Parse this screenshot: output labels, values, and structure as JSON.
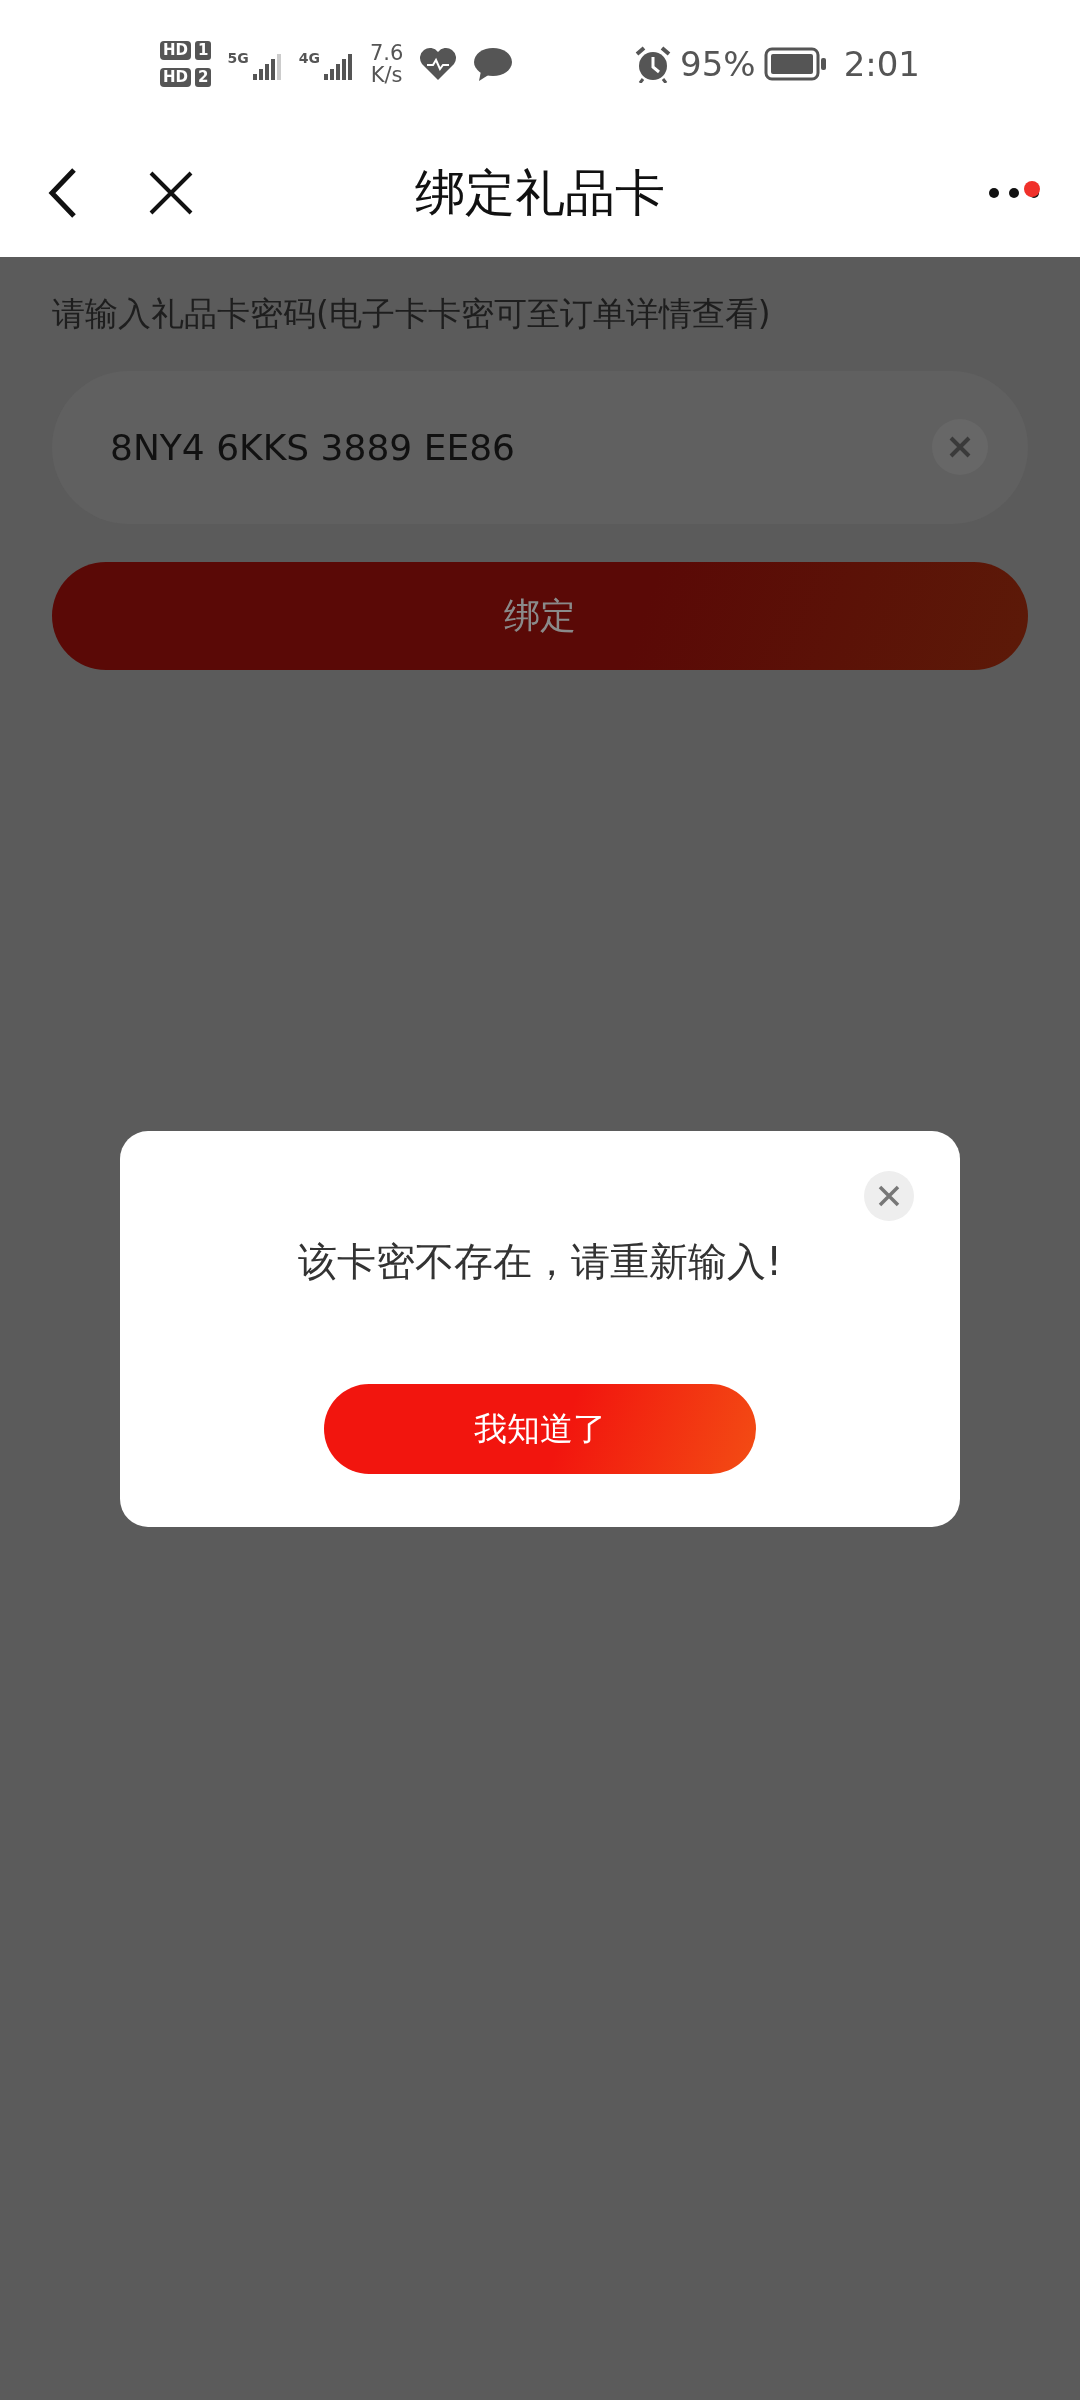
{
  "status_bar": {
    "sims": [
      {
        "badge": "HD",
        "slot": "1"
      },
      {
        "badge": "HD",
        "slot": "2"
      }
    ],
    "networks": [
      "5G",
      "4G"
    ],
    "speed": "7.6",
    "speed_unit": "K/s",
    "battery": "95%",
    "time": "2:01"
  },
  "header": {
    "title": "绑定礼品卡",
    "menu_notification": true
  },
  "form": {
    "label": "请输入礼品卡密码(电子卡卡密可至订单详情查看)",
    "card_code": "8NY4 6KKS 3889 EE86",
    "bind_button": "绑定"
  },
  "dialog": {
    "message": "该卡密不存在，请重新输入!",
    "confirm_button": "我知道了"
  }
}
